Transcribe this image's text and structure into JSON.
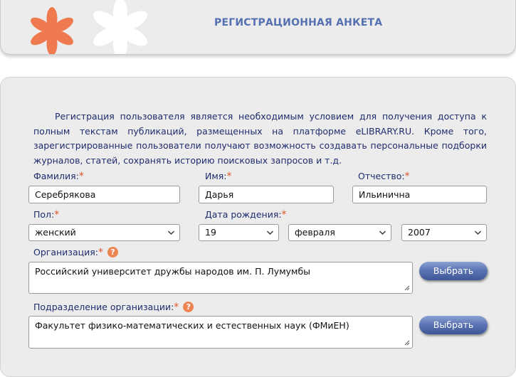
{
  "header": {
    "title": "РЕГИСТРАЦИОННАЯ АНКЕТА"
  },
  "colors": {
    "accent": "#5470b0",
    "text": "#1f2c6e",
    "required": "#e0542a",
    "logo_petal": "#f07a50",
    "button": "#5d75b4"
  },
  "intro": "Регистрация пользователя является необходимым условием для получения доступа к полным текстам публикаций, размещенных на платформе eLIBRARY.RU. Кроме того, зарегистрированные пользователи получают возможность создавать персональные подборки журналов, статей, сохранять историю поисковых запросов и т.д.",
  "form": {
    "required_mark": "*",
    "help_glyph": "?",
    "surname": {
      "label": "Фамилия:",
      "value": "Серебрякова"
    },
    "name": {
      "label": "Имя:",
      "value": "Дарья"
    },
    "patronymic": {
      "label": "Отчество:",
      "value": "Ильинична"
    },
    "gender": {
      "label": "Пол:",
      "value": "женский"
    },
    "birthdate": {
      "label": "Дата рождения:",
      "day": "19",
      "month": "февраля",
      "year": "2007"
    },
    "organization": {
      "label": "Организация:",
      "value": "Российский университет дружбы народов им. П. Лумумбы",
      "button": "Выбрать"
    },
    "department": {
      "label": "Подразделение организации:",
      "value": "Факультет физико-математических и естественных наук (ФМиЕН)",
      "button": "Выбрать"
    }
  },
  "icons": {
    "logo": "flower-logo-icon",
    "chevron": "chevron-down-icon",
    "help": "help-icon",
    "resize": "resize-grip-icon"
  }
}
